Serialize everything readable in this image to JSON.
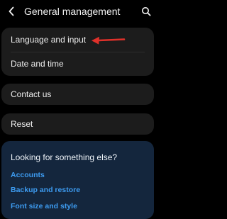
{
  "header": {
    "title": "General management",
    "back_icon": "chevron-left-icon",
    "search_icon": "search-icon"
  },
  "settings_group_1": {
    "items": [
      {
        "label": "Language and input"
      },
      {
        "label": "Date and time"
      }
    ]
  },
  "settings_group_2": {
    "items": [
      {
        "label": "Contact us"
      }
    ]
  },
  "settings_group_3": {
    "items": [
      {
        "label": "Reset"
      }
    ]
  },
  "annotation": {
    "icon": "red-arrow-icon",
    "color": "#e0312a"
  },
  "help": {
    "title": "Looking for something else?",
    "links": [
      {
        "label": "Accounts"
      },
      {
        "label": "Backup and restore"
      },
      {
        "label": "Font size and style"
      }
    ]
  },
  "colors": {
    "background": "#000000",
    "card": "#1c1c1c",
    "help_card": "#14263d",
    "link": "#3d9bf0"
  }
}
